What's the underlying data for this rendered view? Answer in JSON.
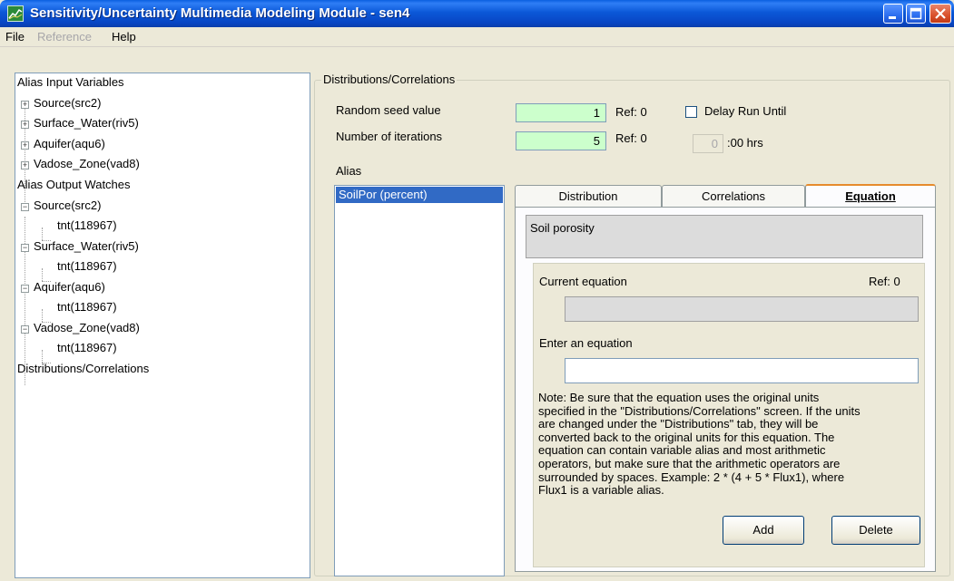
{
  "window": {
    "title": "Sensitivity/Uncertainty Multimedia Modeling Module - sen4",
    "icon": "app-chart-icon",
    "controls": [
      "minimize-icon",
      "maximize-icon",
      "close-icon"
    ]
  },
  "menu": {
    "file": "File",
    "reference": "Reference",
    "help": "Help"
  },
  "tree": {
    "input_header": "Alias Input Variables",
    "inputs": [
      "Source(src2)",
      "Surface_Water(riv5)",
      "Aquifer(aqu6)",
      "Vadose_Zone(vad8)"
    ],
    "output_header": "Alias Output Watches",
    "outputs": [
      {
        "label": "Source(src2)",
        "child": "tnt(118967)"
      },
      {
        "label": "Surface_Water(riv5)",
        "child": "tnt(118967)"
      },
      {
        "label": "Aquifer(aqu6)",
        "child": "tnt(118967)"
      },
      {
        "label": "Vadose_Zone(vad8)",
        "child": "tnt(118967)"
      }
    ],
    "dist_item": "Distributions/Correlations"
  },
  "panel": {
    "group_title": "Distributions/Correlations",
    "seed_label": "Random seed value",
    "seed_value": "1",
    "seed_ref": "Ref: 0",
    "iter_label": "Number of iterations",
    "iter_value": "5",
    "iter_ref": "Ref: 0",
    "delay_label": "Delay Run Until",
    "delay_value": "0",
    "delay_suffix": ":00 hrs",
    "alias_label": "Alias",
    "alias_items": [
      "SoilPor  (percent)"
    ]
  },
  "tabs": {
    "distribution": "Distribution",
    "correlations": "Correlations",
    "equation": "Equation"
  },
  "equation": {
    "description": "Soil porosity",
    "current_label": "Current equation",
    "current_ref": "Ref: 0",
    "current_value": "",
    "enter_label": "Enter an equation",
    "enter_value": "",
    "note_lines": [
      "Note: Be sure that the equation uses the original units",
      "specified in the \"Distributions/Correlations\" screen.  If the units",
      "are changed under the \"Distributions\" tab, they will be",
      "converted back to the original units for this equation.  The",
      "equation can contain variable alias and most arithmetic",
      "operators, but make sure that the arithmetic operators are",
      "surrounded by spaces.  Example: 2 * (4 + 5 * Flux1), where",
      "Flux1 is a variable alias."
    ],
    "add_label": "Add",
    "delete_label": "Delete"
  }
}
